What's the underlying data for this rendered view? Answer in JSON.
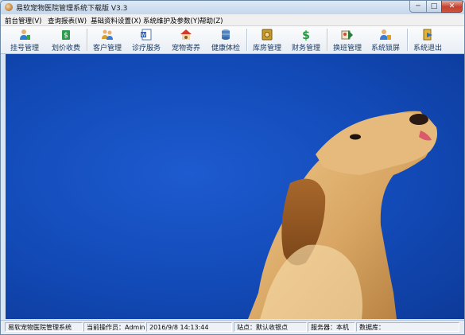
{
  "window": {
    "title": "易软宠物医院管理系统下载版 V3.3",
    "min_label": "─",
    "max_label": "□",
    "close_label": "✕"
  },
  "menu": [
    {
      "label": "前台管理(V)"
    },
    {
      "label": "查询报表(W)"
    },
    {
      "label": "基础资料设置(X)"
    },
    {
      "label": "系统维护及参数(Y)"
    },
    {
      "label": "帮助(Z)"
    }
  ],
  "toolbar": [
    {
      "label": "挂号管理",
      "icon": "register-person-icon"
    },
    {
      "label": "划价收费",
      "icon": "money-icon"
    },
    {
      "label": "客户管理",
      "icon": "customers-icon"
    },
    {
      "label": "诊疗服务",
      "icon": "document-icon"
    },
    {
      "label": "宠物寄养",
      "icon": "pet-house-icon"
    },
    {
      "label": "健康体检",
      "icon": "database-icon"
    },
    {
      "label": "库房管理",
      "icon": "safe-icon"
    },
    {
      "label": "财务管理",
      "icon": "dollar-icon"
    },
    {
      "label": "换班管理",
      "icon": "shift-icon"
    },
    {
      "label": "系统锁屏",
      "icon": "lock-user-icon"
    },
    {
      "label": "系统退出",
      "icon": "exit-door-icon"
    }
  ],
  "status": {
    "app_name": "易软宠物医院管理系统",
    "operator": "当前操作员：Admin",
    "datetime": "2016/9/8 14:13:44",
    "site": "站点：默认收银点",
    "server": "服务器：本机",
    "database": "数据库："
  },
  "colors": {
    "desktop_background": "#124ab7",
    "toolbar_text": "#1d3b63",
    "close_button": "#c4412e"
  }
}
